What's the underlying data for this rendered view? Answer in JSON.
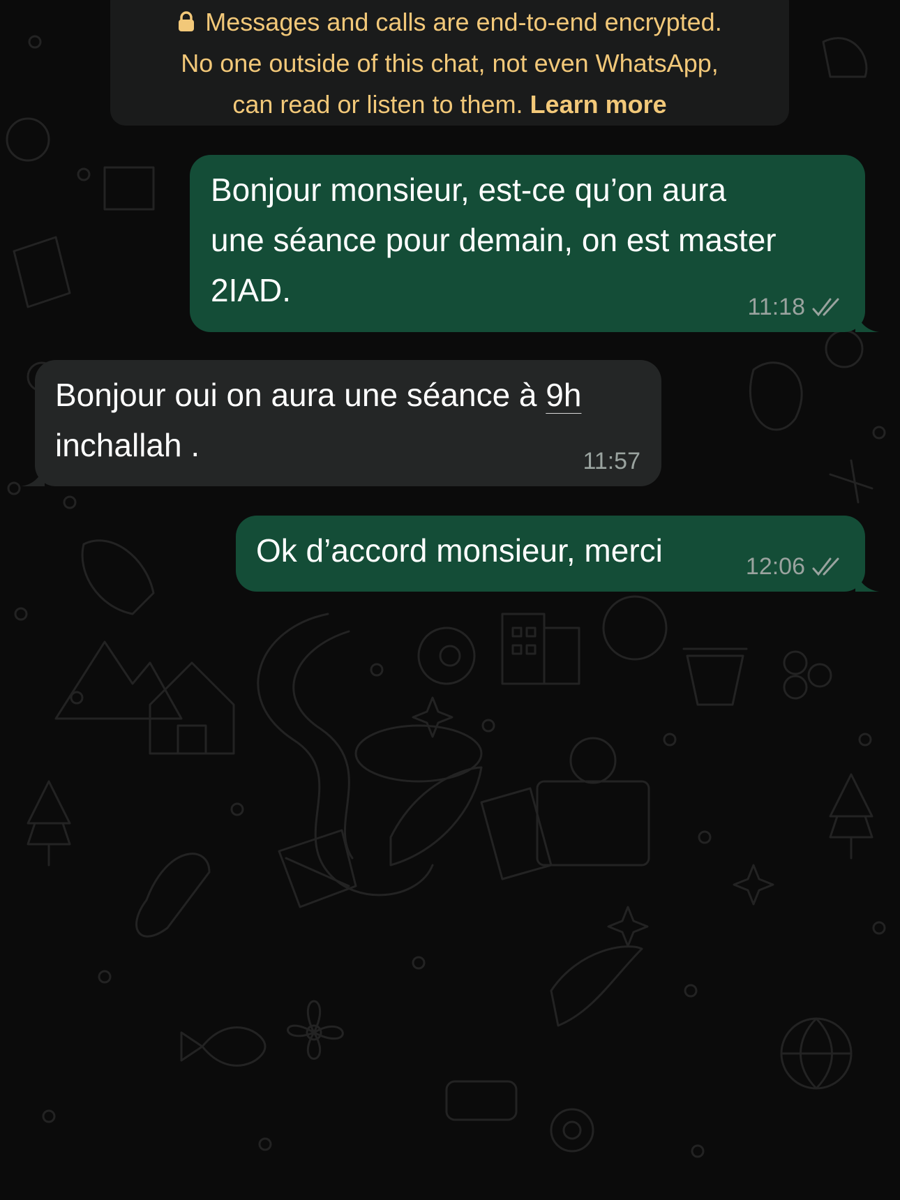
{
  "encryption_notice": {
    "line1": "Messages and calls are end-to-end encrypted.",
    "line2": "No one outside of this chat, not even WhatsApp,",
    "line3_text": "can read or listen to them. ",
    "learn_more": "Learn more",
    "icon": "lock-icon"
  },
  "messages": [
    {
      "direction": "outgoing",
      "lines": [
        "Bonjour monsieur, est-ce qu’on aura",
        "une séance pour demain, on est master",
        "2IAD."
      ],
      "time": "11:18",
      "status_icon": "double-check-icon"
    },
    {
      "direction": "incoming",
      "line1_text": "Bonjour oui on aura une séance à ",
      "line1_link": "9h",
      "line2": "inchallah .",
      "time": "11:57"
    },
    {
      "direction": "outgoing",
      "text": "Ok d’accord monsieur, merci",
      "time": "12:06",
      "status_icon": "double-check-icon"
    }
  ],
  "colors": {
    "background": "#0b0b0b",
    "outgoing_bubble": "#144d37",
    "incoming_bubble": "#242626",
    "notice_bubble": "#1a1b1b",
    "notice_text": "#f2c879",
    "meta_text": "#9aa39f"
  }
}
